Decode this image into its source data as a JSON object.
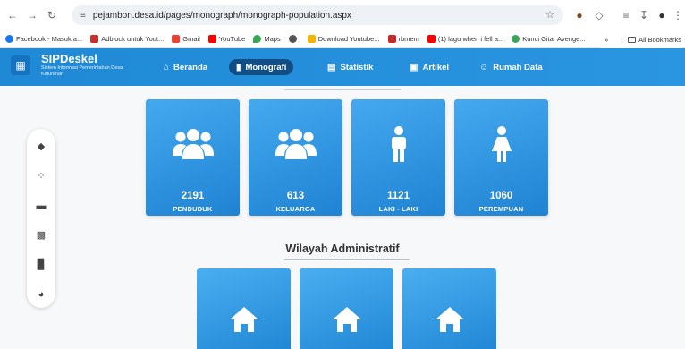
{
  "browser": {
    "url": "pejambon.desa.id/pages/monograph/monograph-population.aspx",
    "bookmarks": [
      {
        "label": "Facebook - Masuk a...",
        "color": "#1877f2"
      },
      {
        "label": "Adblock untuk Yout...",
        "color": "#c9302c"
      },
      {
        "label": "Gmail",
        "color": "#ea4335"
      },
      {
        "label": "YouTube",
        "color": "#ff0000"
      },
      {
        "label": "Maps",
        "color": "#34a853"
      },
      {
        "label": "",
        "color": "#555555"
      },
      {
        "label": "Download Youtube...",
        "color": "#f4b400"
      },
      {
        "label": "rbmem",
        "color": "#c62828"
      },
      {
        "label": "(1) lagu when i fell a...",
        "color": "#ff0000"
      },
      {
        "label": "Kunci Gitar Avenge...",
        "color": "#3ba55d"
      }
    ],
    "bookmarks_more": "»",
    "all_bookmarks": "All Bookmarks"
  },
  "app": {
    "title": "SIPDeskel",
    "subtitle": "Sistem Informasi Pemerintahan Desa Kelurahan",
    "menu": [
      {
        "label": "Beranda",
        "icon": "home-icon",
        "active": false
      },
      {
        "label": "Monografi",
        "icon": "map-icon",
        "active": true
      },
      {
        "label": "Statistik",
        "icon": "chart-icon",
        "active": false
      },
      {
        "label": "Artikel",
        "icon": "article-icon",
        "active": false
      },
      {
        "label": "Rumah Data",
        "icon": "users-icon",
        "active": false
      }
    ]
  },
  "stats": [
    {
      "value": "2191",
      "label": "PENDUDUK",
      "icon": "users-group-icon"
    },
    {
      "value": "613",
      "label": "KELUARGA",
      "icon": "family-icon"
    },
    {
      "value": "1121",
      "label": "LAKI - LAKI",
      "icon": "male-icon"
    },
    {
      "value": "1060",
      "label": "PEREMPUAN",
      "icon": "female-icon"
    }
  ],
  "section": {
    "title": "Wilayah Administratif"
  },
  "colors": {
    "primary": "#1f89d6",
    "active_menu": "#114e86",
    "card_top": "#44a9ef",
    "card_bottom": "#1f83d3"
  }
}
